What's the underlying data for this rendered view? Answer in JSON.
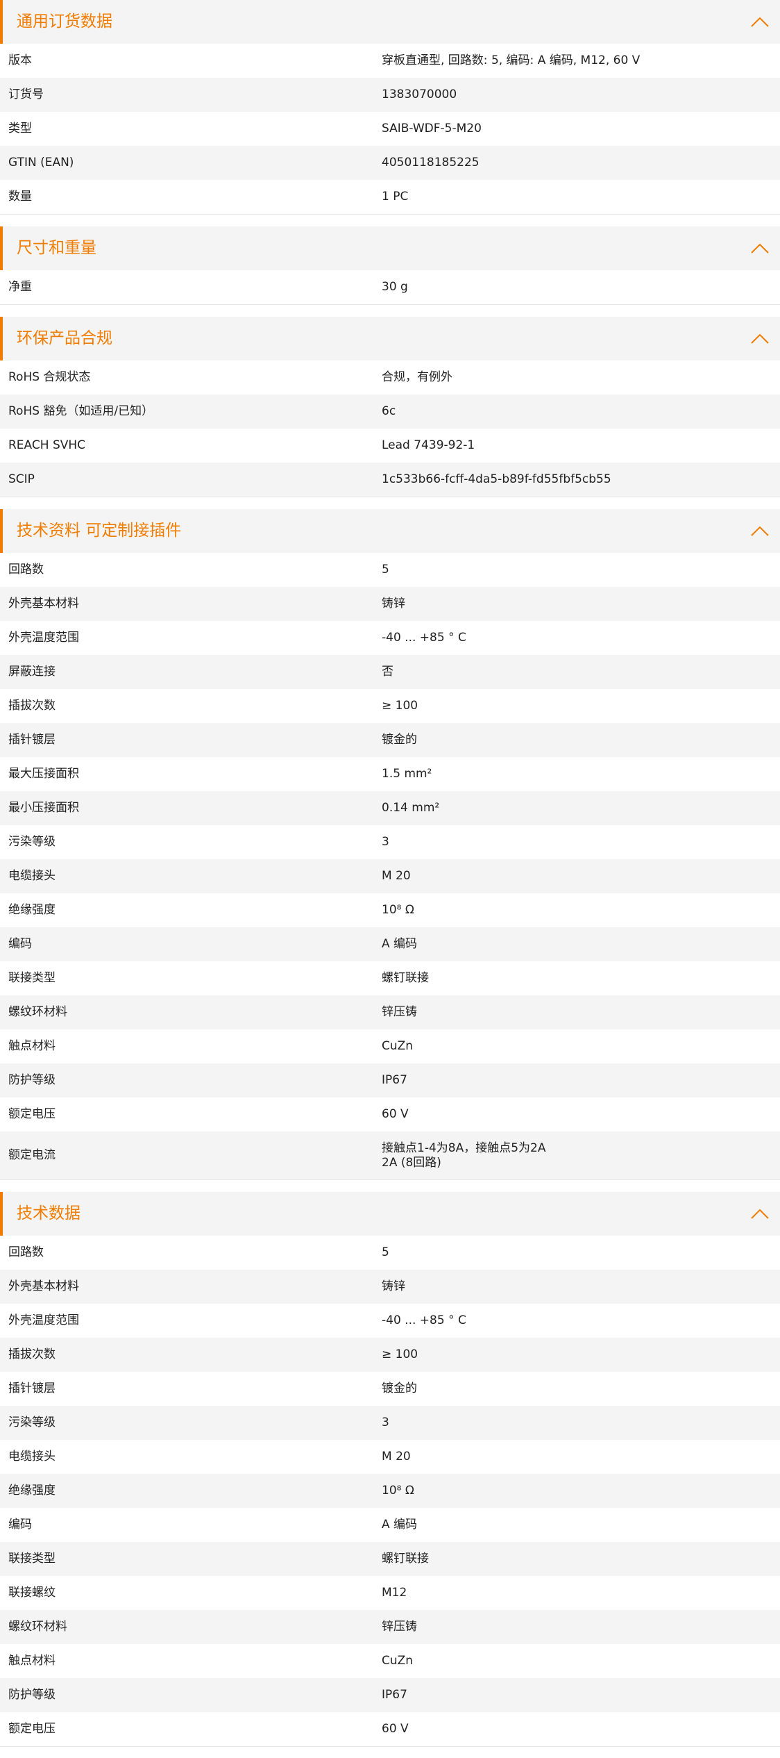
{
  "colors": {
    "accent": "#f07d00",
    "row_alt": "#f4f4f4"
  },
  "icons": {
    "collapse": "chevron-up-icon"
  },
  "sections": [
    {
      "title": "通用订货数据",
      "rows": [
        {
          "label": "版本",
          "value": "穿板直通型, 回路数: 5, 编码: A 编码, M12, 60 V"
        },
        {
          "label": "订货号",
          "value": "1383070000"
        },
        {
          "label": "类型",
          "value": "SAIB-WDF-5-M20"
        },
        {
          "label": "GTIN (EAN)",
          "value": "4050118185225"
        },
        {
          "label": "数量",
          "value": "1  PC"
        }
      ]
    },
    {
      "title": "尺寸和重量",
      "rows": [
        {
          "label": "净重",
          "value": "30  g"
        }
      ]
    },
    {
      "title": "环保产品合规",
      "rows": [
        {
          "label": "RoHS 合规状态",
          "value": "合规，有例外"
        },
        {
          "label": "RoHS 豁免（如适用/已知）",
          "value": "6c"
        },
        {
          "label": "REACH SVHC",
          "value": "Lead 7439-92-1"
        },
        {
          "label": "SCIP",
          "value": "1c533b66-fcff-4da5-b89f-fd55fbf5cb55"
        }
      ]
    },
    {
      "title": "技术资料 可定制接插件",
      "rows": [
        {
          "label": "回路数",
          "value": "5"
        },
        {
          "label": "外壳基本材料",
          "value": "铸锌"
        },
        {
          "label": "外壳温度范围",
          "value": "-40 ... +85 ° C"
        },
        {
          "label": "屏蔽连接",
          "value": "否"
        },
        {
          "label": "插拔次数",
          "value": "≥ 100"
        },
        {
          "label": "插针镀层",
          "value": "镀金的"
        },
        {
          "label": "最大压接面积",
          "value": "1.5  mm²"
        },
        {
          "label": "最小压接面积",
          "value": "0.14  mm²"
        },
        {
          "label": "污染等级",
          "value": "3"
        },
        {
          "label": "电缆接头",
          "value": "M 20"
        },
        {
          "label": "绝缘强度",
          "value": "10⁸ Ω"
        },
        {
          "label": "编码",
          "value": "A 编码"
        },
        {
          "label": "联接类型",
          "value": "螺钉联接"
        },
        {
          "label": "螺纹环材料",
          "value": "锌压铸"
        },
        {
          "label": "触点材料",
          "value": "CuZn"
        },
        {
          "label": "防护等级",
          "value": "IP67"
        },
        {
          "label": "额定电压",
          "value": "60  V"
        },
        {
          "label": "额定电流",
          "value": "接触点1-4为8A，接触点5为2A\n2A (8回路)",
          "multi": true
        }
      ]
    },
    {
      "title": "技术数据",
      "rows": [
        {
          "label": "回路数",
          "value": "5"
        },
        {
          "label": "外壳基本材料",
          "value": "铸锌"
        },
        {
          "label": "外壳温度范围",
          "value": "-40 ... +85 ° C"
        },
        {
          "label": "插拔次数",
          "value": "≥ 100"
        },
        {
          "label": "插针镀层",
          "value": "镀金的"
        },
        {
          "label": "污染等级",
          "value": "3"
        },
        {
          "label": "电缆接头",
          "value": "M 20"
        },
        {
          "label": "绝缘强度",
          "value": "10⁸ Ω"
        },
        {
          "label": "编码",
          "value": "A 编码"
        },
        {
          "label": "联接类型",
          "value": "螺钉联接"
        },
        {
          "label": "联接螺纹",
          "value": "M12"
        },
        {
          "label": "螺纹环材料",
          "value": "锌压铸"
        },
        {
          "label": "触点材料",
          "value": "CuZn"
        },
        {
          "label": "防护等级",
          "value": "IP67"
        },
        {
          "label": "额定电压",
          "value": "60  V"
        }
      ]
    }
  ]
}
